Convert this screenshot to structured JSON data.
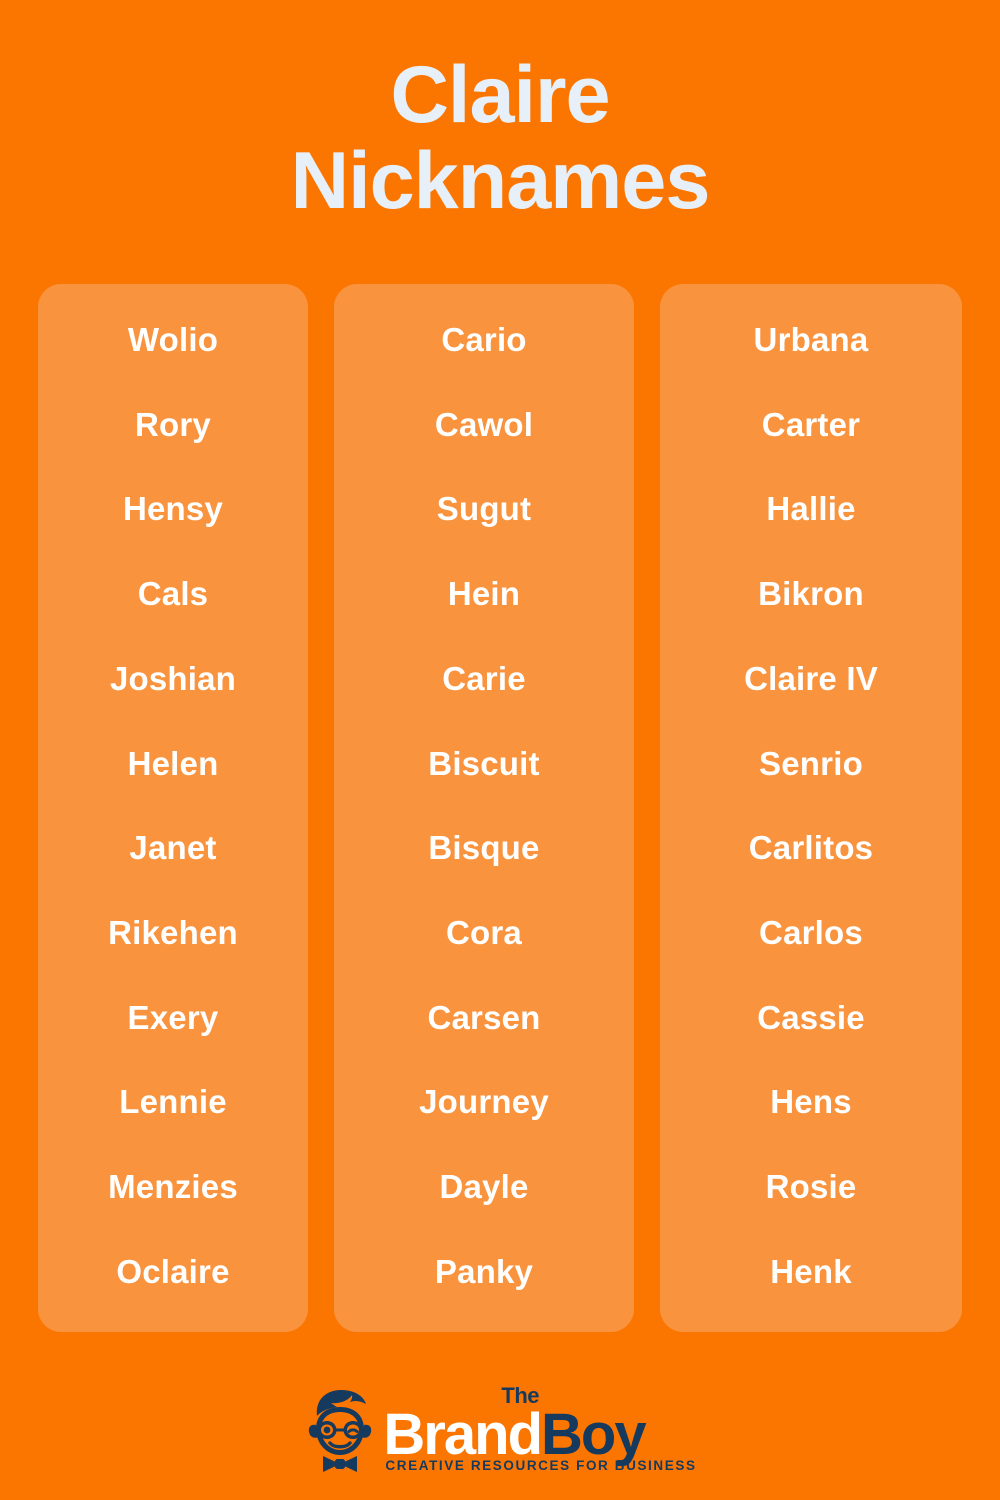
{
  "page": {
    "background_color": "#fb7600",
    "card_color": "#f9933d",
    "title_color": "#e7f0f8",
    "name_color": "#ffffff",
    "logo_navy": "#16395e"
  },
  "title": {
    "line1": "Claire",
    "line2": "Nicknames"
  },
  "columns": [
    {
      "id": "column-1",
      "names": [
        "Wolio",
        "Rory",
        "Hensy",
        "Cals",
        "Joshian",
        "Helen",
        "Janet",
        "Rikehen",
        "Exery",
        "Lennie",
        "Menzies",
        "Oclaire"
      ]
    },
    {
      "id": "column-2",
      "names": [
        "Cario",
        "Cawol",
        "Sugut",
        "Hein",
        "Carie",
        "Biscuit",
        "Bisque",
        "Cora",
        "Carsen",
        "Journey",
        "Dayle",
        "Panky"
      ]
    },
    {
      "id": "column-3",
      "names": [
        "Urbana",
        "Carter",
        "Hallie",
        "Bikron",
        "Claire IV",
        "Senrio",
        "Carlitos",
        "Carlos",
        "Cassie",
        "Hens",
        "Rosie",
        "Henk"
      ]
    }
  ],
  "logo": {
    "the": "The",
    "brand": "Brand",
    "boy": "Boy",
    "tagline": "CREATIVE RESOURCES FOR BUSINESS",
    "mascot_name": "brandboy-mascot-icon"
  }
}
